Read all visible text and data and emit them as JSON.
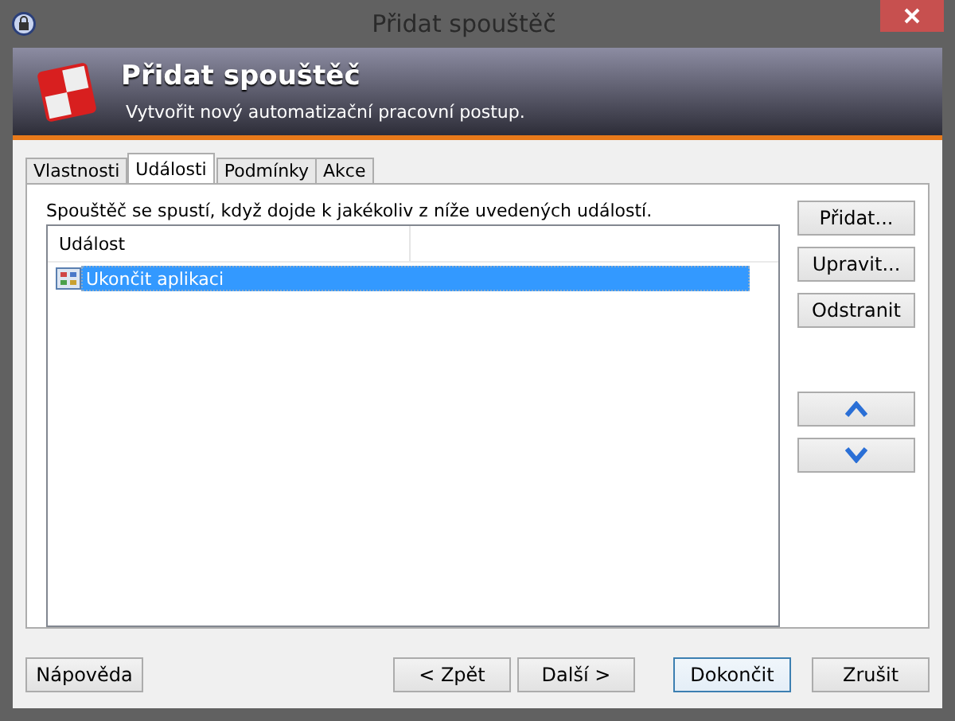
{
  "window": {
    "title": "Přidat spouštěč"
  },
  "header": {
    "title": "Přidat spouštěč",
    "subtitle": "Vytvořit nový automatizační pracovní postup."
  },
  "tabs": [
    {
      "label": "Vlastnosti",
      "selected": false
    },
    {
      "label": "Události",
      "selected": true
    },
    {
      "label": "Podmínky",
      "selected": false
    },
    {
      "label": "Akce",
      "selected": false
    }
  ],
  "description": "Spouštěč se spustí, když dojde k jakékoliv z níže uvedených událostí.",
  "event_list": {
    "columns": [
      "Událost"
    ],
    "rows": [
      {
        "label": "Ukončit aplikaci",
        "selected": true
      }
    ]
  },
  "edit_buttons": [
    "Přidat...",
    "Upravit...",
    "Odstranit"
  ],
  "move_buttons": [
    {
      "kind": "up"
    },
    {
      "kind": "down"
    }
  ],
  "footer": {
    "help": {
      "label": "Nápověda",
      "default": false
    },
    "navigation": [
      {
        "label": "< Zpět",
        "default": false
      },
      {
        "label": "Další >",
        "default": false
      }
    ],
    "actions": [
      {
        "label": "Dokončit",
        "default": true
      },
      {
        "label": "Zrušit",
        "default": false
      }
    ]
  }
}
